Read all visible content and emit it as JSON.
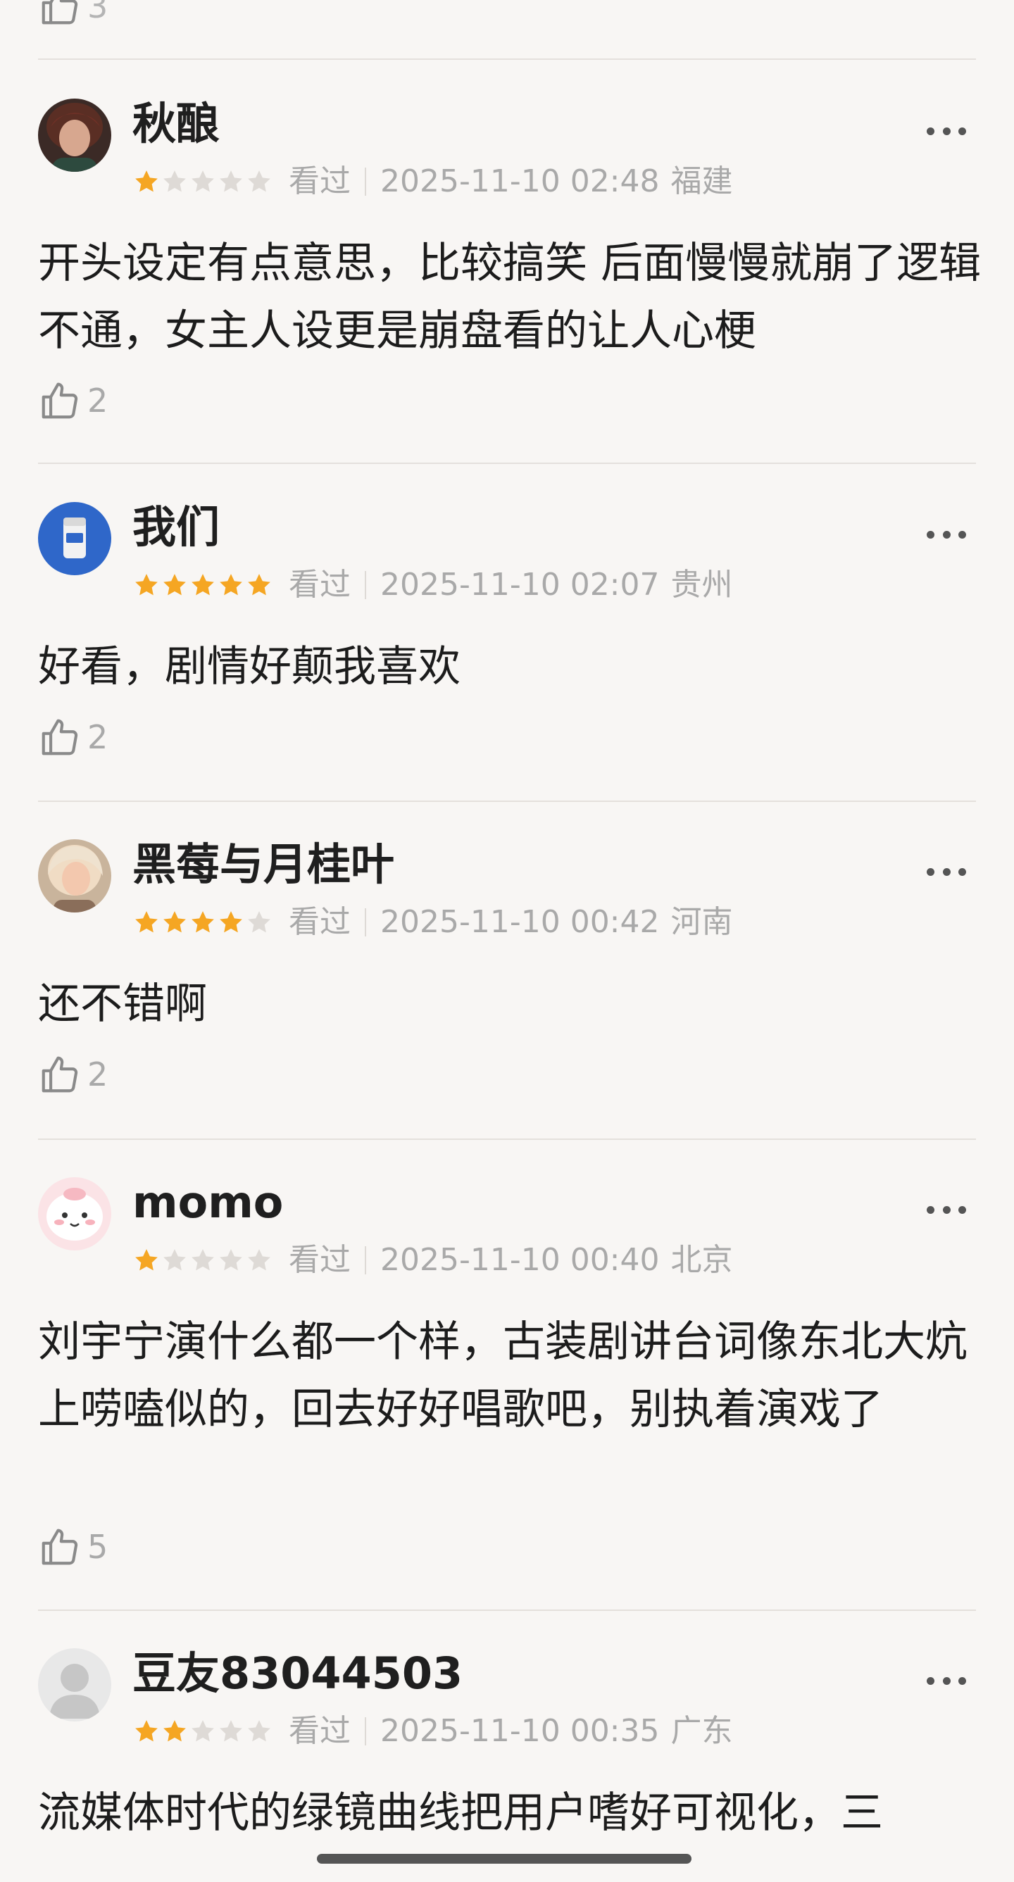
{
  "top_partial": {
    "like_count": "3"
  },
  "reviews": [
    {
      "username": "秋酿",
      "rating": 1,
      "status": "看过",
      "time": "2025-11-10 02:48",
      "location": "福建",
      "content": "开头设定有点意思，比较搞笑 后面慢慢就崩了逻辑不通，女主人设更是崩盘看的让人心梗",
      "likes": "2",
      "avatar_icon": "portrait-avatar-icon"
    },
    {
      "username": "我们",
      "rating": 5,
      "status": "看过",
      "time": "2025-11-10 02:07",
      "location": "贵州",
      "content": "好看，剧情好颠我喜欢",
      "likes": "2",
      "avatar_icon": "cup-avatar-icon"
    },
    {
      "username": "黑莓与月桂叶",
      "rating": 4,
      "status": "看过",
      "time": "2025-11-10 00:42",
      "location": "河南",
      "content": "还不错啊",
      "likes": "2",
      "avatar_icon": "portrait-avatar-icon"
    },
    {
      "username": "momo",
      "rating": 1,
      "status": "看过",
      "time": "2025-11-10 00:40",
      "location": "北京",
      "content": "刘宇宁演什么都一个样，古装剧讲台词像东北大炕上唠嗑似的，回去好好唱歌吧，别执着演戏了",
      "likes": "5",
      "avatar_icon": "cartoon-avatar-icon"
    },
    {
      "username": "豆友83044503",
      "rating": 2,
      "status": "看过",
      "time": "2025-11-10 00:35",
      "location": "广东",
      "content": "流媒体时代的绿镜曲线把用户嗜好可视化，三",
      "likes": "",
      "avatar_icon": "default-user-avatar-icon"
    }
  ],
  "colors": {
    "background": "#f8f6f4",
    "star_filled": "#f5a623",
    "star_empty": "#dedad6",
    "meta_text": "#a9a9a9",
    "divider": "#e4e0dc"
  },
  "icons": {
    "like": "thumbs-up-icon",
    "more": "more-dots-icon"
  }
}
